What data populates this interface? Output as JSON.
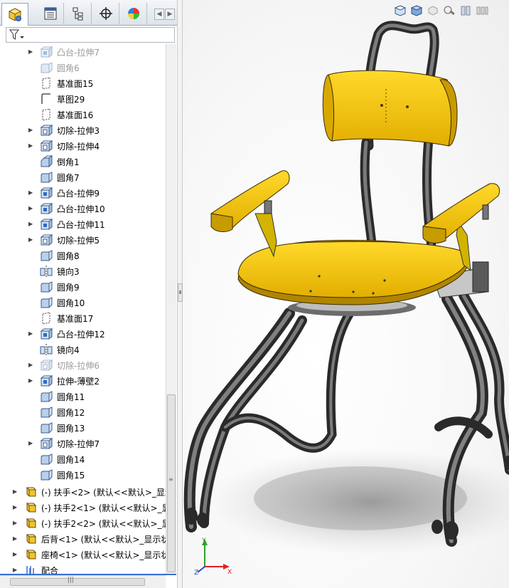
{
  "tabs": [
    {
      "name": "feature-manager-tab",
      "icon": "cube-assembly-icon"
    },
    {
      "name": "property-manager-tab",
      "icon": "property-list-icon"
    },
    {
      "name": "configuration-manager-tab",
      "icon": "configuration-icon"
    },
    {
      "name": "dimxpert-tab",
      "icon": "crosshair-icon"
    },
    {
      "name": "display-manager-tab",
      "icon": "appearance-pie-icon"
    }
  ],
  "tree": [
    {
      "label": "凸台-拉伸7",
      "icon": "boss-extrude",
      "expander": true,
      "dim": true
    },
    {
      "label": "圆角6",
      "icon": "fillet",
      "expander": false,
      "dim": true
    },
    {
      "label": "基准面15",
      "icon": "plane",
      "expander": false,
      "dim": false
    },
    {
      "label": "草图29",
      "icon": "sketch",
      "expander": false,
      "dim": false
    },
    {
      "label": "基准面16",
      "icon": "plane",
      "expander": false,
      "dim": false
    },
    {
      "label": "切除-拉伸3",
      "icon": "cut-extrude",
      "expander": true,
      "dim": false
    },
    {
      "label": "切除-拉伸4",
      "icon": "cut-extrude",
      "expander": true,
      "dim": false
    },
    {
      "label": "倒角1",
      "icon": "chamfer",
      "expander": false,
      "dim": false
    },
    {
      "label": "圆角7",
      "icon": "fillet",
      "expander": false,
      "dim": false
    },
    {
      "label": "凸台-拉伸9",
      "icon": "boss-extrude",
      "expander": true,
      "dim": false
    },
    {
      "label": "凸台-拉伸10",
      "icon": "boss-extrude",
      "expander": true,
      "dim": false
    },
    {
      "label": "凸台-拉伸11",
      "icon": "boss-extrude",
      "expander": true,
      "dim": false
    },
    {
      "label": "切除-拉伸5",
      "icon": "cut-extrude",
      "expander": true,
      "dim": false
    },
    {
      "label": "圆角8",
      "icon": "fillet",
      "expander": false,
      "dim": false
    },
    {
      "label": "镜向3",
      "icon": "mirror",
      "expander": false,
      "dim": false
    },
    {
      "label": "圆角9",
      "icon": "fillet",
      "expander": false,
      "dim": false
    },
    {
      "label": "圆角10",
      "icon": "fillet",
      "expander": false,
      "dim": false
    },
    {
      "label": "基准面17",
      "icon": "plane",
      "expander": false,
      "dim": false
    },
    {
      "label": "凸台-拉伸12",
      "icon": "boss-extrude",
      "expander": true,
      "dim": false
    },
    {
      "label": "镜向4",
      "icon": "mirror",
      "expander": false,
      "dim": false
    },
    {
      "label": "切除-拉伸6",
      "icon": "cut-extrude",
      "expander": true,
      "dim": true
    },
    {
      "label": "拉伸-薄壁2",
      "icon": "boss-extrude",
      "expander": true,
      "dim": false
    },
    {
      "label": "圆角11",
      "icon": "fillet",
      "expander": false,
      "dim": false
    },
    {
      "label": "圆角12",
      "icon": "fillet",
      "expander": false,
      "dim": false
    },
    {
      "label": "圆角13",
      "icon": "fillet",
      "expander": false,
      "dim": false
    },
    {
      "label": "切除-拉伸7",
      "icon": "cut-extrude",
      "expander": true,
      "dim": false
    },
    {
      "label": "圆角14",
      "icon": "fillet",
      "expander": false,
      "dim": false
    },
    {
      "label": "圆角15",
      "icon": "fillet",
      "expander": false,
      "dim": false
    }
  ],
  "components": [
    {
      "label": "(-) 扶手<2> (默认<<默认>_显示",
      "icon": "part-component"
    },
    {
      "label": "(-) 扶手2<1> (默认<<默认>_显",
      "icon": "part-component"
    },
    {
      "label": "(-) 扶手2<2> (默认<<默认>_显",
      "icon": "part-component"
    },
    {
      "label": "后背<1> (默认<<默认>_显示状",
      "icon": "part-component"
    },
    {
      "label": "座椅<1> (默认<<默认>_显示状",
      "icon": "part-component"
    },
    {
      "label": "配合",
      "icon": "mates"
    }
  ],
  "viewtools": [
    {
      "name": "view-orientation-icon"
    },
    {
      "name": "display-style-icon"
    },
    {
      "name": "hide-show-icon"
    },
    {
      "name": "edit-appearance-icon"
    },
    {
      "name": "section-view-icon"
    },
    {
      "name": "view-settings-icon"
    }
  ],
  "triad": {
    "x": "X",
    "y": "Y",
    "z": "Z"
  },
  "colors": {
    "seat_yellow": "#f2c200",
    "frame_gray": "#5a5a5a",
    "selection_blue": "#3a6fd2"
  }
}
